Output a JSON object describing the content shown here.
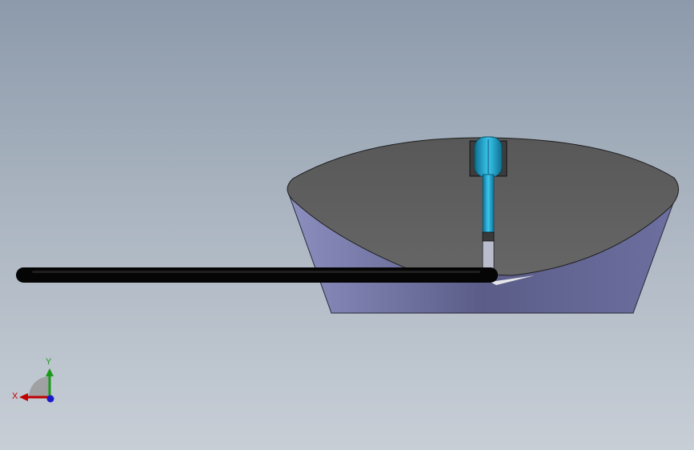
{
  "viewport": {
    "background_top": "#8c9aab",
    "background_bottom": "#c7ced6"
  },
  "model": {
    "bowl_top_color": "#5f5f5f",
    "bowl_side_color": "#7a7ca8",
    "rod_color": "#050505",
    "knob_color": "#1ca9d6"
  },
  "triad": {
    "x_label": "X",
    "y_label": "Y",
    "x_color": "#c00000",
    "y_color": "#1a9a1a",
    "z_color": "#1a1acc"
  }
}
